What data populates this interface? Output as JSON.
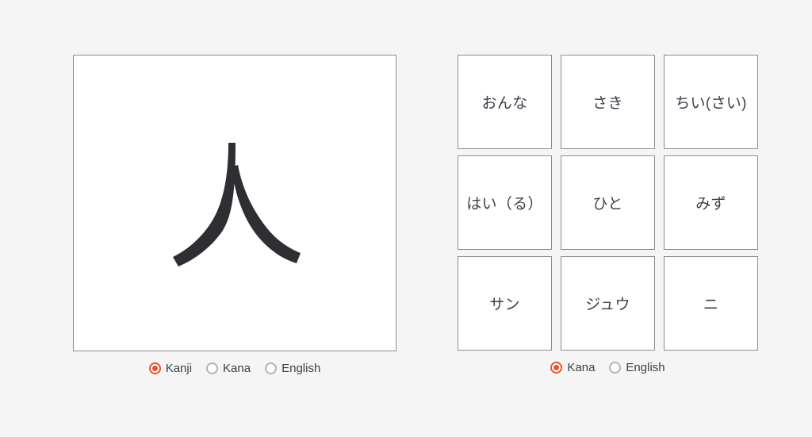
{
  "colors": {
    "page_background": "#f5f5f5",
    "card_background": "#ffffff",
    "card_border": "#8a8d90",
    "text": "#3a4149",
    "radio_selected": "#e8542a",
    "radio_unselected": "#b0b3b6",
    "kanji_stroke": "#2f2f33"
  },
  "prompt_card": {
    "kanji": "人",
    "kanji_meaning_icon": "kanji-character-person"
  },
  "prompt_modes": {
    "options": [
      {
        "label": "Kanji",
        "selected": true
      },
      {
        "label": "Kana",
        "selected": false
      },
      {
        "label": "English",
        "selected": false
      }
    ]
  },
  "answer_grid": {
    "rows": 3,
    "columns": 3,
    "cells": [
      {
        "text": "おんな"
      },
      {
        "text": "さき"
      },
      {
        "text": "ちい(さい)"
      },
      {
        "text": "はい（る）"
      },
      {
        "text": "ひと"
      },
      {
        "text": "みず"
      },
      {
        "text": "サン"
      },
      {
        "text": "ジュウ"
      },
      {
        "text": "ニ"
      }
    ]
  },
  "answer_modes": {
    "options": [
      {
        "label": "Kana",
        "selected": true
      },
      {
        "label": "English",
        "selected": false
      }
    ]
  }
}
